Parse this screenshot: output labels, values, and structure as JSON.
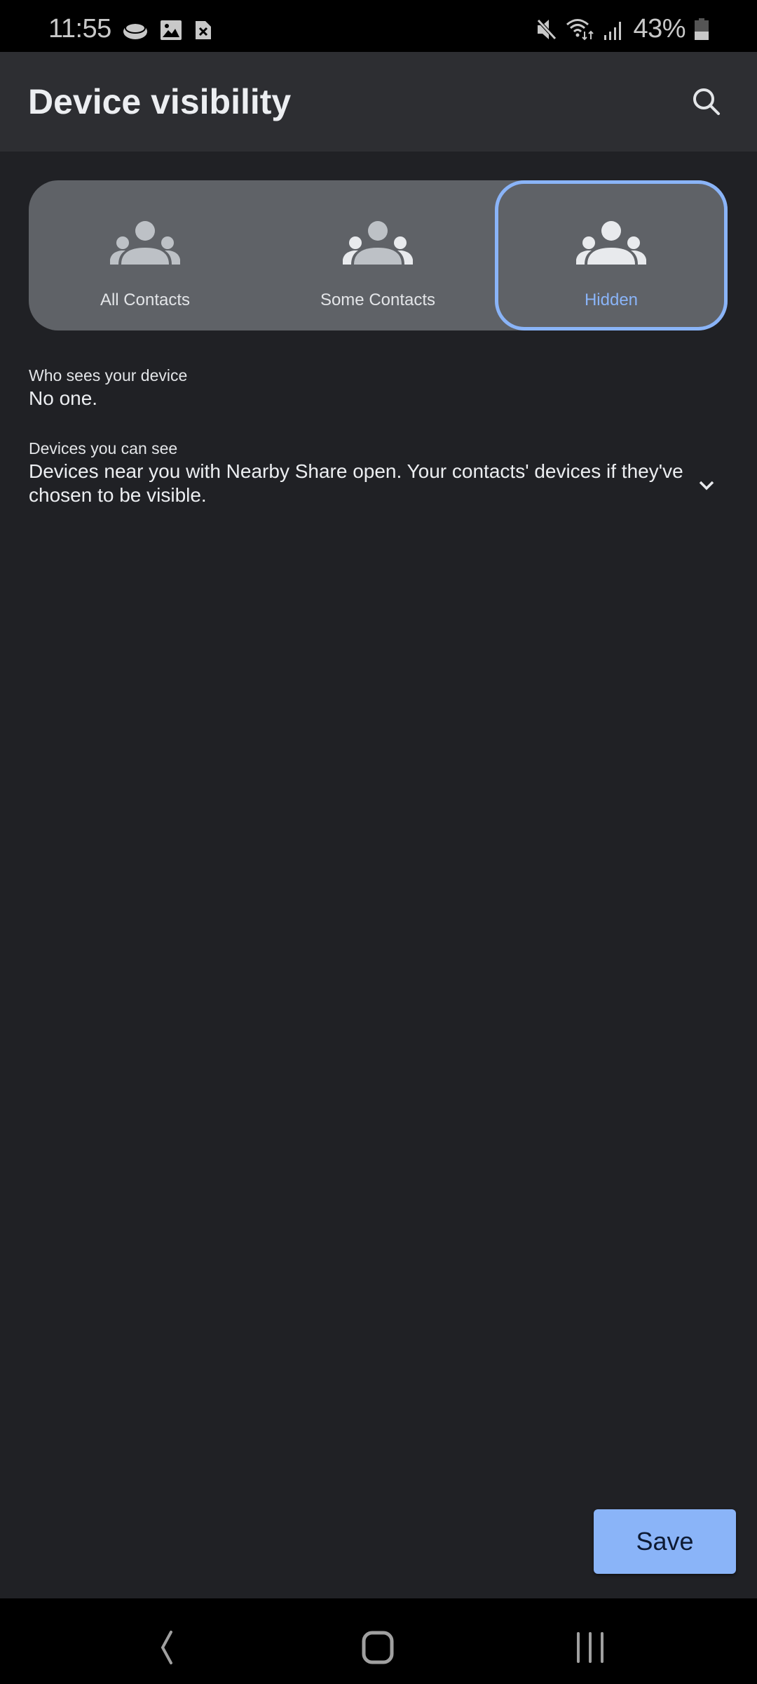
{
  "status_bar": {
    "time": "11:55",
    "left_icons": [
      "bixby-icon",
      "gallery-icon",
      "sim-error-icon"
    ],
    "right_icons": [
      "mute-icon",
      "wifi-icon",
      "signal-icon"
    ],
    "battery_percent": "43%",
    "battery_level": 0.43
  },
  "header": {
    "title": "Device visibility",
    "search_icon": "search-icon"
  },
  "visibility_options": [
    {
      "label": "All Contacts",
      "icon": "group-icon",
      "selected": false
    },
    {
      "label": "Some Contacts",
      "icon": "group-icon",
      "selected": false
    },
    {
      "label": "Hidden",
      "icon": "group-icon",
      "selected": true
    }
  ],
  "info": {
    "who_sees_label": "Who sees your device",
    "who_sees_value": "No one.",
    "devices_label": "Devices you can see",
    "devices_value": "Devices near you with Nearby Share open. Your contacts' devices if they've chosen to be visible."
  },
  "actions": {
    "save_label": "Save"
  },
  "colors": {
    "accent": "#8ab4f8",
    "background": "#202125",
    "appbar": "#2d2e32",
    "segment": "#5f6267"
  },
  "nav_bar": {
    "buttons": [
      "back-icon",
      "home-icon",
      "recents-icon"
    ]
  }
}
